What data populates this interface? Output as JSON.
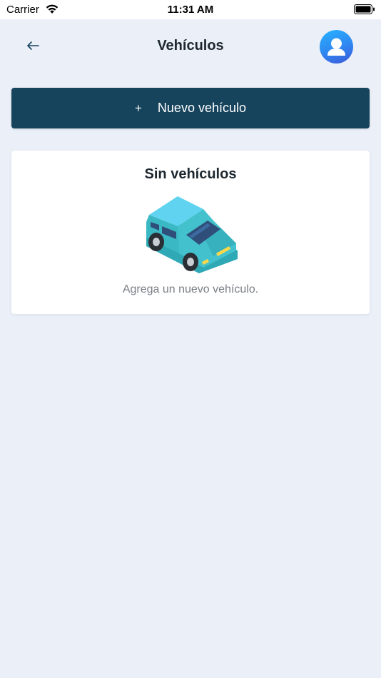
{
  "status_bar": {
    "carrier": "Carrier",
    "time": "11:31 AM"
  },
  "header": {
    "title": "Vehículos",
    "back_icon": "arrow-left-icon",
    "avatar_icon": "user-avatar-icon"
  },
  "actions": {
    "new_vehicle_label": "Nuevo vehículo",
    "plus_symbol": "+"
  },
  "empty_state": {
    "title": "Sin vehículos",
    "message": "Agrega un nuevo vehículo.",
    "illustration": "car-icon"
  },
  "colors": {
    "background": "#ebeff8",
    "primary_button": "#17445d",
    "avatar_gradient": [
      "#27b3ff",
      "#3c59d8"
    ],
    "car_body": "#3ab8c4"
  }
}
